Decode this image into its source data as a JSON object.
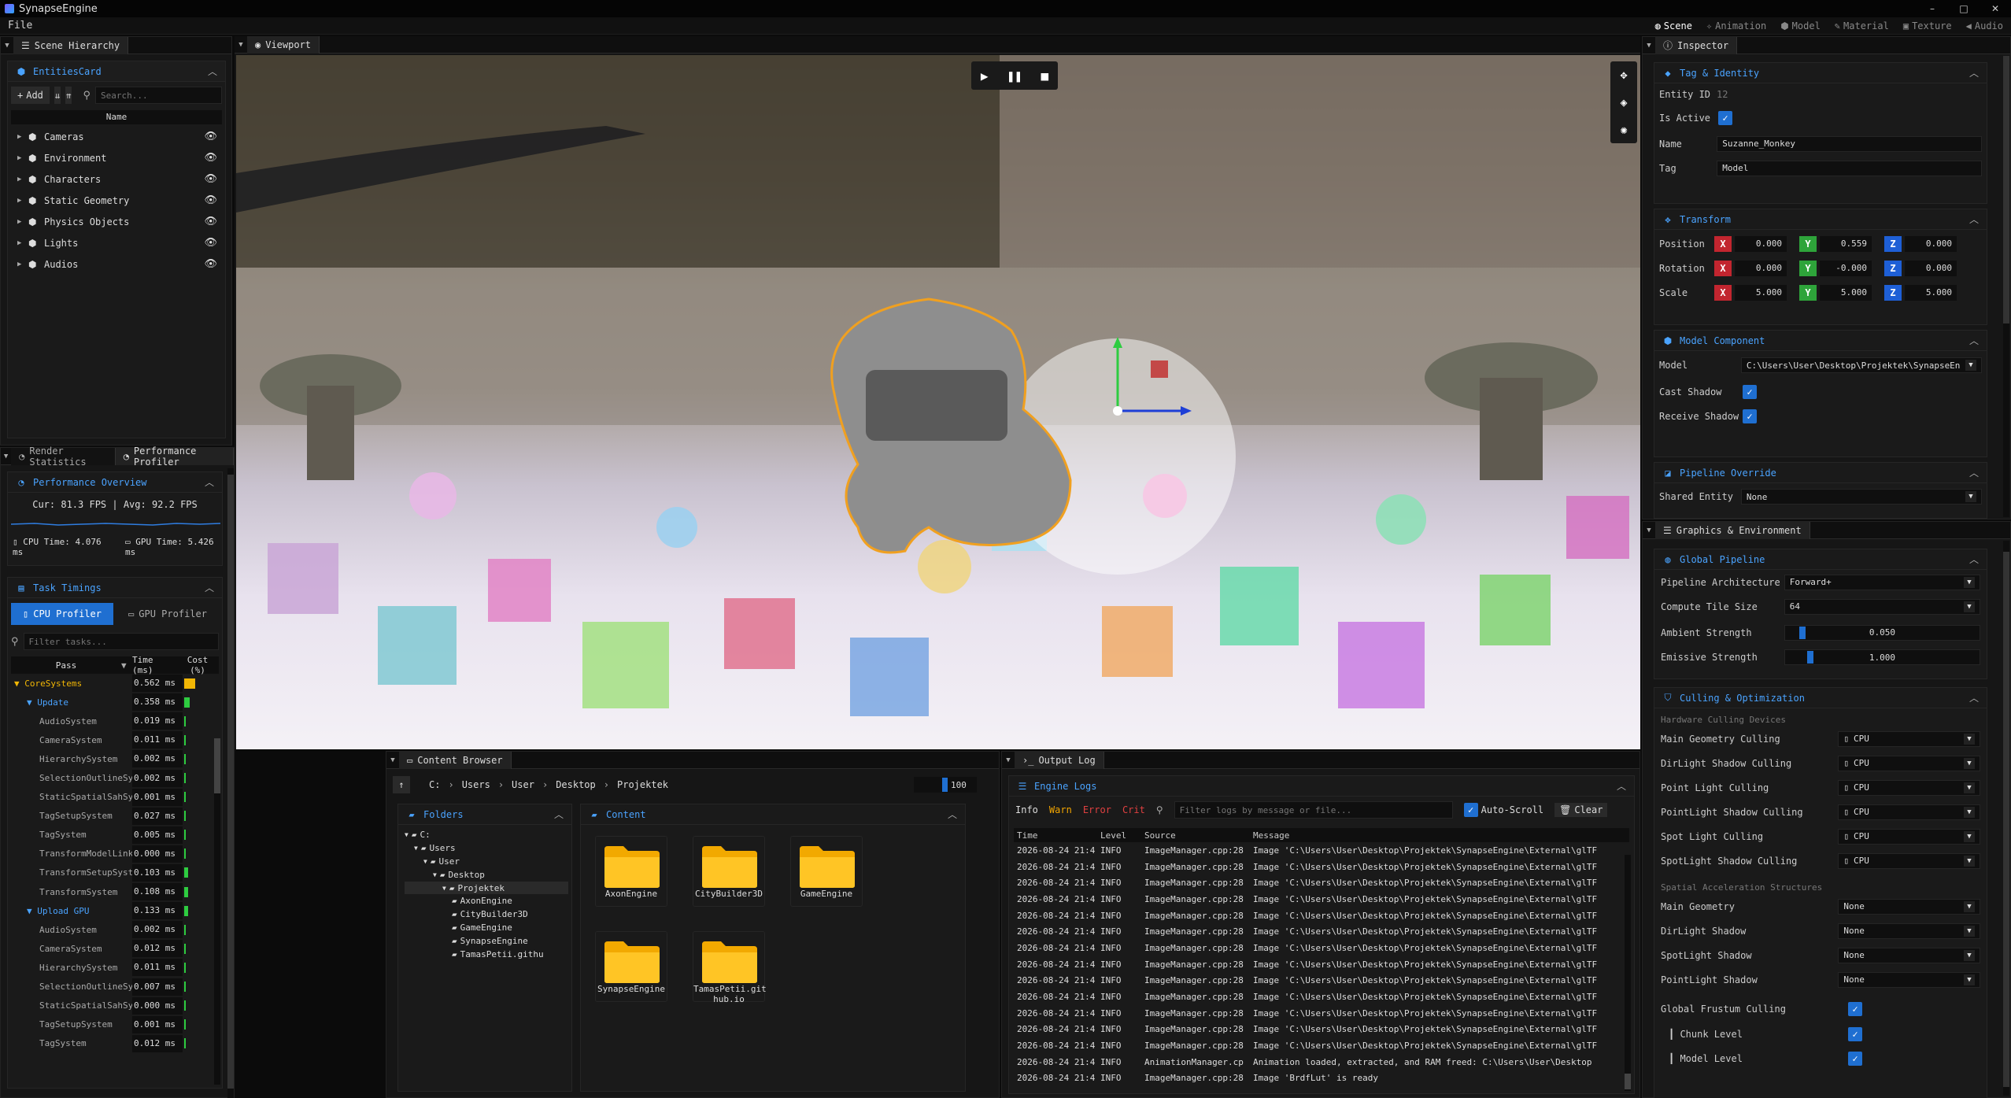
{
  "app": {
    "title": "SynapseEngine",
    "menu_file": "File",
    "win_min": "–",
    "win_max": "□",
    "win_close": "✕"
  },
  "modes": [
    {
      "label": "Scene",
      "active": true,
      "icon": "globe-icon"
    },
    {
      "label": "Animation",
      "icon": "run-icon"
    },
    {
      "label": "Model",
      "icon": "cube-icon"
    },
    {
      "label": "Material",
      "icon": "brush-icon"
    },
    {
      "label": "Texture",
      "icon": "image-icon"
    },
    {
      "label": "Audio",
      "icon": "speaker-icon"
    }
  ],
  "hierarchy": {
    "tab": "Scene Hierarchy",
    "card_title": "EntitiesCard",
    "add": "Add",
    "search_placeholder": "Search...",
    "col_name": "Name",
    "items": [
      "Cameras",
      "Environment",
      "Characters",
      "Static Geometry",
      "Physics Objects",
      "Lights",
      "Audios"
    ]
  },
  "perf": {
    "tab1": "Render Statistics",
    "tab2": "Performance Profiler",
    "overview": "Performance Overview",
    "fps": "Cur: 81.3 FPS | Avg: 92.2 FPS",
    "cpu_time": "CPU Time: 4.076 ms",
    "gpu_time": "GPU Time: 5.426 ms",
    "task_timings": "Task Timings",
    "cpu_profiler": "CPU Profiler",
    "gpu_profiler": "GPU Profiler",
    "filter_placeholder": "Filter tasks...",
    "col_pass": "Pass",
    "col_time": "Time (ms)",
    "col_cost": "Cost (%)",
    "rows": [
      {
        "name": "CoreSystems",
        "time": "0.562 ms",
        "level": 0,
        "group": true,
        "cost": 0.9,
        "color": "#f2b705"
      },
      {
        "name": "Update",
        "time": "0.358 ms",
        "level": 1,
        "group": true,
        "cost": 0.45,
        "color": "#2ecc40"
      },
      {
        "name": "AudioSystem",
        "time": "0.019 ms",
        "level": 2,
        "cost": 0.1,
        "color": "#2ecc40"
      },
      {
        "name": "CameraSystem",
        "time": "0.011 ms",
        "level": 2,
        "cost": 0.06,
        "color": "#2ecc40"
      },
      {
        "name": "HierarchySystem",
        "time": "0.002 ms",
        "level": 2,
        "cost": 0.02,
        "color": "#2ecc40"
      },
      {
        "name": "SelectionOutlineSystem",
        "time": "0.002 ms",
        "level": 2,
        "cost": 0.02,
        "color": "#2ecc40"
      },
      {
        "name": "StaticSpatialSahSystem",
        "time": "0.001 ms",
        "level": 2,
        "cost": 0.01,
        "color": "#2ecc40"
      },
      {
        "name": "TagSetupSystem",
        "time": "0.027 ms",
        "level": 2,
        "cost": 0.12,
        "color": "#2ecc40"
      },
      {
        "name": "TagSystem",
        "time": "0.005 ms",
        "level": 2,
        "cost": 0.04,
        "color": "#2ecc40"
      },
      {
        "name": "TransformModelLinkSystem",
        "time": "0.000 ms",
        "level": 2,
        "cost": 0.0,
        "color": "#2ecc40"
      },
      {
        "name": "TransformSetupSystem",
        "time": "0.103 ms",
        "level": 2,
        "cost": 0.3,
        "color": "#2ecc40"
      },
      {
        "name": "TransformSystem",
        "time": "0.108 ms",
        "level": 2,
        "cost": 0.3,
        "color": "#2ecc40"
      },
      {
        "name": "Upload GPU",
        "time": "0.133 ms",
        "level": 1,
        "group": true,
        "cost": 0.3,
        "color": "#2ecc40"
      },
      {
        "name": "AudioSystem",
        "time": "0.002 ms",
        "level": 2,
        "cost": 0.02,
        "color": "#2ecc40"
      },
      {
        "name": "CameraSystem",
        "time": "0.012 ms",
        "level": 2,
        "cost": 0.06,
        "color": "#2ecc40"
      },
      {
        "name": "HierarchySystem",
        "time": "0.011 ms",
        "level": 2,
        "cost": 0.06,
        "color": "#2ecc40"
      },
      {
        "name": "SelectionOutlineSystem",
        "time": "0.007 ms",
        "level": 2,
        "cost": 0.04,
        "color": "#2ecc40"
      },
      {
        "name": "StaticSpatialSahSystem",
        "time": "0.000 ms",
        "level": 2,
        "cost": 0.0,
        "color": "#2ecc40"
      },
      {
        "name": "TagSetupSystem",
        "time": "0.001 ms",
        "level": 2,
        "cost": 0.01,
        "color": "#2ecc40"
      },
      {
        "name": "TagSystem",
        "time": "0.012 ms",
        "level": 2,
        "cost": 0.06,
        "color": "#2ecc40"
      }
    ]
  },
  "viewport": {
    "tab": "Viewport"
  },
  "content": {
    "tab": "Content Browser",
    "crumbs": [
      "C:",
      "Users",
      "User",
      "Desktop",
      "Projektek"
    ],
    "zoom": "100",
    "folders_title": "Folders",
    "content_title": "Content",
    "tree": [
      {
        "label": "C:",
        "level": 0
      },
      {
        "label": "Users",
        "level": 1
      },
      {
        "label": "User",
        "level": 2
      },
      {
        "label": "Desktop",
        "level": 3
      },
      {
        "label": "Projektek",
        "level": 4,
        "selected": true
      },
      {
        "label": "AxonEngine",
        "level": 5
      },
      {
        "label": "CityBuilder3D",
        "level": 5
      },
      {
        "label": "GameEngine",
        "level": 5
      },
      {
        "label": "SynapseEngine",
        "level": 5
      },
      {
        "label": "TamasPetii.githu",
        "level": 5
      }
    ],
    "items": [
      "AxonEngine",
      "CityBuilder3D",
      "GameEngine",
      "SynapseEngine",
      "TamasPetii.git\nhub.io"
    ]
  },
  "output": {
    "tab": "Output Log",
    "title": "Engine Logs",
    "f_info": "Info",
    "f_warn": "Warn",
    "f_error": "Error",
    "f_crit": "Crit",
    "filter_placeholder": "Filter logs by message or file...",
    "autoscroll": "Auto-Scroll",
    "clear": "Clear",
    "col_time": "Time",
    "col_level": "Level",
    "col_source": "Source",
    "col_message": "Message",
    "rows": [
      {
        "t": "2026-08-24 21:4",
        "l": "INFO",
        "s": "ImageManager.cpp:28",
        "m": "Image 'C:\\Users\\User\\Desktop\\Projektek\\SynapseEngine\\External\\glTF"
      },
      {
        "t": "2026-08-24 21:4",
        "l": "INFO",
        "s": "ImageManager.cpp:28",
        "m": "Image 'C:\\Users\\User\\Desktop\\Projektek\\SynapseEngine\\External\\glTF"
      },
      {
        "t": "2026-08-24 21:4",
        "l": "INFO",
        "s": "ImageManager.cpp:28",
        "m": "Image 'C:\\Users\\User\\Desktop\\Projektek\\SynapseEngine\\External\\glTF"
      },
      {
        "t": "2026-08-24 21:4",
        "l": "INFO",
        "s": "ImageManager.cpp:28",
        "m": "Image 'C:\\Users\\User\\Desktop\\Projektek\\SynapseEngine\\External\\glTF"
      },
      {
        "t": "2026-08-24 21:4",
        "l": "INFO",
        "s": "ImageManager.cpp:28",
        "m": "Image 'C:\\Users\\User\\Desktop\\Projektek\\SynapseEngine\\External\\glTF"
      },
      {
        "t": "2026-08-24 21:4",
        "l": "INFO",
        "s": "ImageManager.cpp:28",
        "m": "Image 'C:\\Users\\User\\Desktop\\Projektek\\SynapseEngine\\External\\glTF"
      },
      {
        "t": "2026-08-24 21:4",
        "l": "INFO",
        "s": "ImageManager.cpp:28",
        "m": "Image 'C:\\Users\\User\\Desktop\\Projektek\\SynapseEngine\\External\\glTF"
      },
      {
        "t": "2026-08-24 21:4",
        "l": "INFO",
        "s": "ImageManager.cpp:28",
        "m": "Image 'C:\\Users\\User\\Desktop\\Projektek\\SynapseEngine\\External\\glTF"
      },
      {
        "t": "2026-08-24 21:4",
        "l": "INFO",
        "s": "ImageManager.cpp:28",
        "m": "Image 'C:\\Users\\User\\Desktop\\Projektek\\SynapseEngine\\External\\glTF"
      },
      {
        "t": "2026-08-24 21:4",
        "l": "INFO",
        "s": "ImageManager.cpp:28",
        "m": "Image 'C:\\Users\\User\\Desktop\\Projektek\\SynapseEngine\\External\\glTF"
      },
      {
        "t": "2026-08-24 21:4",
        "l": "INFO",
        "s": "ImageManager.cpp:28",
        "m": "Image 'C:\\Users\\User\\Desktop\\Projektek\\SynapseEngine\\External\\glTF"
      },
      {
        "t": "2026-08-24 21:4",
        "l": "INFO",
        "s": "ImageManager.cpp:28",
        "m": "Image 'C:\\Users\\User\\Desktop\\Projektek\\SynapseEngine\\External\\glTF"
      },
      {
        "t": "2026-08-24 21:4",
        "l": "INFO",
        "s": "ImageManager.cpp:28",
        "m": "Image 'C:\\Users\\User\\Desktop\\Projektek\\SynapseEngine\\External\\glTF"
      },
      {
        "t": "2026-08-24 21:4",
        "l": "INFO",
        "s": "AnimationManager.cp",
        "m": "Animation loaded, extracted, and RAM freed: C:\\Users\\User\\Desktop"
      },
      {
        "t": "2026-08-24 21:4",
        "l": "INFO",
        "s": "ImageManager.cpp:28",
        "m": "Image 'BrdfLut' is ready"
      }
    ]
  },
  "inspector": {
    "tab": "Inspector",
    "tag_identity": "Tag & Identity",
    "entity_id_label": "Entity ID",
    "entity_id": "12",
    "is_active": "Is Active",
    "name_label": "Name",
    "name": "Suzanne_Monkey",
    "tag_label": "Tag",
    "tag": "Model",
    "transform": "Transform",
    "position": "Position",
    "rotation": "Rotation",
    "scale": "Scale",
    "pos": [
      "0.000",
      "0.559",
      "0.000"
    ],
    "rot": [
      "0.000",
      "-0.000",
      "0.000"
    ],
    "scl": [
      "5.000",
      "5.000",
      "5.000"
    ],
    "model_component": "Model Component",
    "model_label": "Model",
    "model_path": "C:\\Users\\User\\Desktop\\Projektek\\SynapseEn",
    "cast_shadow": "Cast Shadow",
    "receive_shadow": "Receive Shadow",
    "pipeline_override": "Pipeline Override",
    "shared_entity": "Shared Entity",
    "shared_entity_val": "None"
  },
  "graphics": {
    "tab": "Graphics & Environment",
    "global_pipeline": "Global Pipeline",
    "arch_label": "Pipeline Architecture",
    "arch": "Forward+",
    "tile_label": "Compute Tile Size",
    "tile": "64",
    "ambient_label": "Ambient Strength",
    "ambient": "0.050",
    "ambient_level": 0.05,
    "emissive_label": "Emissive Strength",
    "emissive": "1.000",
    "emissive_level": 0.1,
    "culling": "Culling & Optimization",
    "hw_devices": "Hardware Culling Devices",
    "cull_rows": [
      {
        "label": "Main Geometry Culling",
        "val": "CPU"
      },
      {
        "label": "DirLight Shadow Culling",
        "val": "CPU"
      },
      {
        "label": "Point Light Culling",
        "val": "CPU"
      },
      {
        "label": "PointLight Shadow Culling",
        "val": "CPU"
      },
      {
        "label": "Spot Light Culling",
        "val": "CPU"
      },
      {
        "label": "SpotLight Shadow Culling",
        "val": "CPU"
      }
    ],
    "spatial": "Spatial Acceleration Structures",
    "spatial_rows": [
      {
        "label": "Main Geometry",
        "val": "None"
      },
      {
        "label": "DirLight Shadow",
        "val": "None"
      },
      {
        "label": "SpotLight Shadow",
        "val": "None"
      },
      {
        "label": "PointLight Shadow",
        "val": "None"
      }
    ],
    "frustum": "Global Frustum Culling",
    "chunk": "Chunk Level",
    "modellevel": "Model Level"
  }
}
